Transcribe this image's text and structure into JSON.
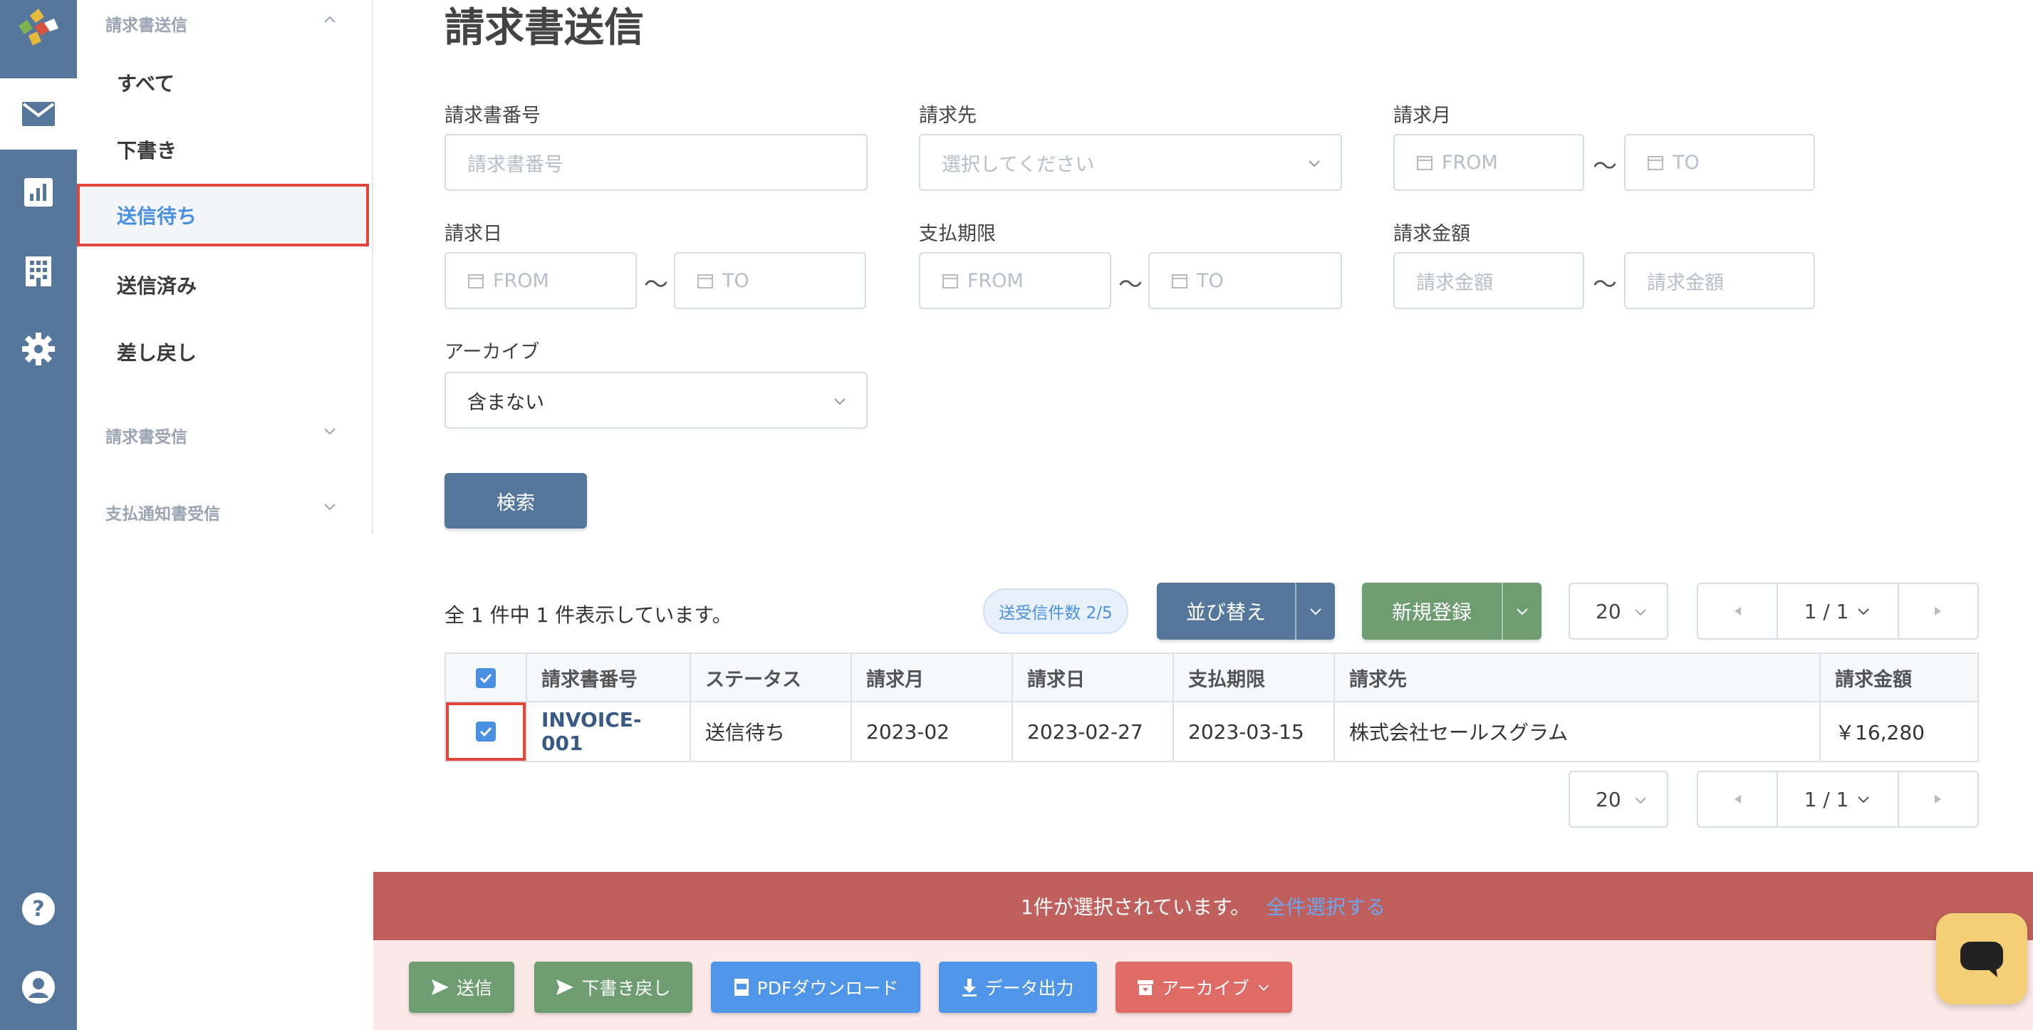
{
  "colors": {
    "rail": "#56779c",
    "accent": "#4a90e2",
    "danger": "#e0463a",
    "green": "#6d9d70",
    "selbar": "#c0605c"
  },
  "rail": {
    "items": [
      "mail-icon",
      "chart-icon",
      "building-icon",
      "gear-icon",
      "help-icon",
      "user-icon"
    ]
  },
  "sidebar": {
    "section1": "請求書送信",
    "items": [
      {
        "label": "すべて"
      },
      {
        "label": "下書き"
      },
      {
        "label": "送信待ち"
      },
      {
        "label": "送信済み"
      },
      {
        "label": "差し戻し"
      }
    ],
    "section2": "請求書受信",
    "section3": "支払通知書受信"
  },
  "page": {
    "title": "請求書送信"
  },
  "filters": {
    "invoice_no": {
      "label": "請求書番号",
      "placeholder": "請求書番号"
    },
    "client": {
      "label": "請求先",
      "placeholder": "選択してください"
    },
    "month": {
      "label": "請求月",
      "from": "FROM",
      "to": "TO"
    },
    "date": {
      "label": "請求日",
      "from": "FROM",
      "to": "TO"
    },
    "due": {
      "label": "支払期限",
      "from": "FROM",
      "to": "TO"
    },
    "amount": {
      "label": "請求金額",
      "from": "請求金額",
      "to": "請求金額"
    },
    "archive": {
      "label": "アーカイブ",
      "value": "含まない"
    },
    "tilde": "〜",
    "search_label": "検索"
  },
  "list": {
    "count_text": "全 1 件中 1 件表示しています。",
    "badge": "送受信件数 2/5",
    "sort_label": "並び替え",
    "new_label": "新規登録",
    "per_page": "20",
    "page": "1 / 1"
  },
  "table": {
    "headers": [
      "請求書番号",
      "ステータス",
      "請求月",
      "請求日",
      "支払期限",
      "請求先",
      "請求金額"
    ],
    "rows": [
      {
        "invoice": "INVOICE-001",
        "status": "送信待ち",
        "month": "2023-02",
        "date": "2023-02-27",
        "due": "2023-03-15",
        "client": "株式会社セールスグラム",
        "amount": "￥16,280"
      }
    ]
  },
  "selection": {
    "text": "1件が選択されています。",
    "select_all": "全件選択する"
  },
  "actions": {
    "send": "送信",
    "revert": "下書き戻し",
    "pdf": "PDFダウンロード",
    "export": "データ出力",
    "archive": "アーカイブ"
  }
}
